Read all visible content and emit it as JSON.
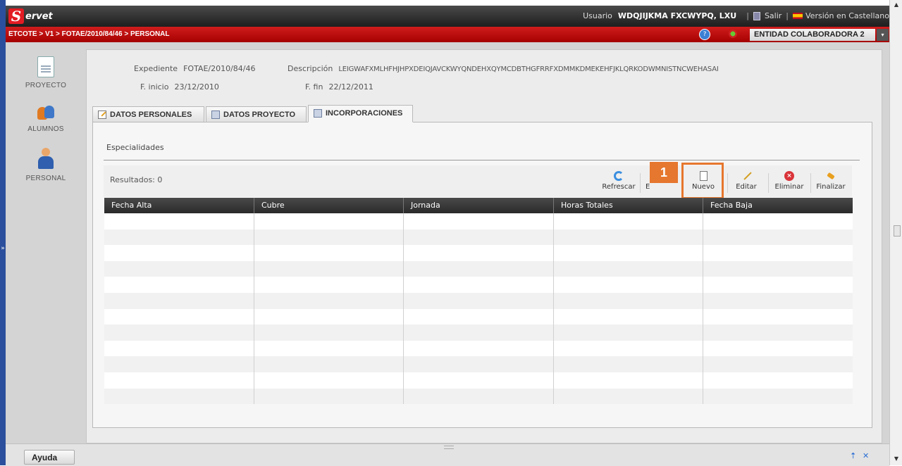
{
  "header": {
    "logo_initial": "S",
    "logo_rest": "ervet",
    "user_label": "Usuario",
    "user_name": "WDQJIJKMA FXCWYPQ, LXU",
    "separator": "|",
    "exit_label": "Salir",
    "language_label": "Versión en Castellano"
  },
  "breadcrumb": "ETCOTE > V1 > FOTAE/2010/84/46 > PERSONAL",
  "entity_selector": {
    "value": "ENTIDAD COLABORADORA 2",
    "arrow": "▾"
  },
  "sidebar": {
    "items": [
      {
        "label": "PROYECTO",
        "icon": "document-icon"
      },
      {
        "label": "ALUMNOS",
        "icon": "people-icon"
      },
      {
        "label": "PERSONAL",
        "icon": "person-icon"
      }
    ]
  },
  "record": {
    "expediente_label": "Expediente",
    "expediente_value": "FOTAE/2010/84/46",
    "descripcion_label": "Descripción",
    "descripcion_value": "LEIGWAFXMLHFHJHPXDEIQJAVCKWYQNDEHXQYMCDBTHGFRRFXDMMKDMEKEHFJKLQRKODWMNISTNCWEHASAI",
    "inicio_label": "F. inicio",
    "inicio_value": "23/12/2010",
    "fin_label": "F. fin",
    "fin_value": "22/12/2011"
  },
  "tabs": [
    {
      "label": "DATOS PERSONALES",
      "icon": "edit-icon"
    },
    {
      "label": "DATOS PROYECTO",
      "icon": "list-icon"
    },
    {
      "label": "INCORPORACIONES",
      "icon": "grid-icon",
      "active": true
    }
  ],
  "section": {
    "title": "Especialidades"
  },
  "results_label": "Resultados: 0",
  "toolbar": {
    "refresh": "Refrescar",
    "export_partial": "E",
    "new": "Nuevo",
    "edit": "Editar",
    "delete": "Eliminar",
    "finish": "Finalizar"
  },
  "step_badge": "1",
  "table": {
    "columns": [
      "Fecha Alta",
      "Cubre",
      "Jornada",
      "Horas Totales",
      "Fecha Baja"
    ],
    "rows": []
  },
  "footer": {
    "help_label": "Ayuda"
  },
  "colors": {
    "brand_red": "#d11d1d",
    "highlight_orange": "#e6772e",
    "frame_blue": "#2b4f9c"
  }
}
